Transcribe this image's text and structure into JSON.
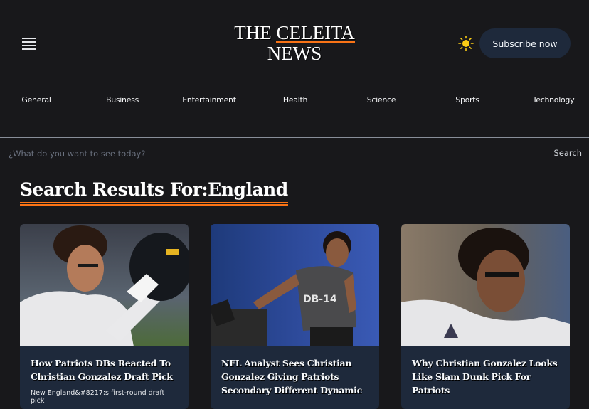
{
  "header": {
    "logo_line1_plain": "THE ",
    "logo_line1_accent": "CELEITA",
    "logo_line2": "NEWS",
    "menu_icon": "hamburger-icon",
    "theme_icon": "sun-icon",
    "subscribe_label": "Subscribe now"
  },
  "nav": {
    "items": [
      {
        "label": "General"
      },
      {
        "label": "Business"
      },
      {
        "label": "Entertainment"
      },
      {
        "label": "Health"
      },
      {
        "label": "Science"
      },
      {
        "label": "Sports"
      },
      {
        "label": "Technology"
      }
    ]
  },
  "search": {
    "placeholder": "¿What do you want to see today?",
    "value": "",
    "button_label": "Search"
  },
  "results": {
    "title": "Search Results For:England",
    "cards": [
      {
        "title": "How Patriots DBs Reacted To Christian Gonzalez Draft Pick",
        "excerpt": "New England&#8217;s first-round draft pick",
        "image_alt": "Football player in white Oregon uniform holding black helmet"
      },
      {
        "title": "NFL Analyst Sees Christian Gonzalez Giving Patriots Secondary Different Dynamic",
        "excerpt": "",
        "image_alt": "Player in grey DB-14 combine shirt running drill"
      },
      {
        "title": "Why Christian Gonzalez Looks Like Slam Dunk Pick For Patriots",
        "excerpt": "",
        "image_alt": "Football player in white Oregon uniform with eye black"
      }
    ]
  },
  "colors": {
    "background": "#18181b",
    "accent": "#f97316",
    "card": "#1e293b",
    "sun": "#facc15"
  }
}
